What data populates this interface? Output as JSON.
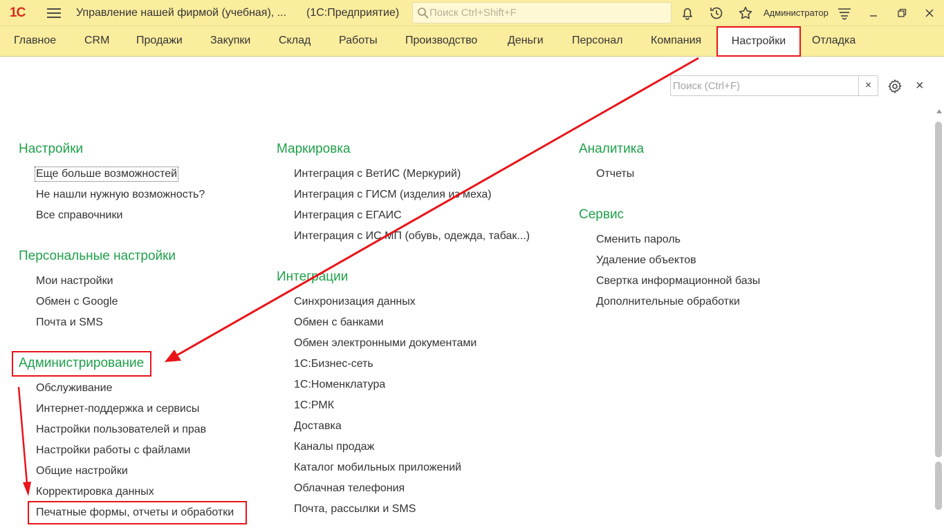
{
  "titlebar": {
    "logo": "1С",
    "app_title": "Управление нашей фирмой (учебная), ...",
    "app_subtitle": "(1С:Предприятие)",
    "search_placeholder": "Поиск Ctrl+Shift+F",
    "user_name": "Администратор",
    "icons": [
      "bell-icon",
      "history-icon",
      "star-icon",
      "menu-lines-icon",
      "restore-window-icon",
      "close-icon"
    ]
  },
  "sections": [
    {
      "label": "Главное"
    },
    {
      "label": "CRM"
    },
    {
      "label": "Продажи"
    },
    {
      "label": "Закупки"
    },
    {
      "label": "Склад"
    },
    {
      "label": "Работы"
    },
    {
      "label": "Производство"
    },
    {
      "label": "Деньги"
    },
    {
      "label": "Персонал"
    },
    {
      "label": "Компания"
    },
    {
      "label": "Настройки"
    },
    {
      "label": "Отладка"
    }
  ],
  "panel": {
    "search_placeholder": "Поиск (Ctrl+F)",
    "clear_label": "×",
    "close_label": "×"
  },
  "col1": {
    "g1": {
      "title": "Настройки",
      "items": [
        "Еще больше возможностей",
        "Не нашли нужную возможность?",
        "Все справочники"
      ]
    },
    "g2": {
      "title": "Персональные настройки",
      "items": [
        "Мои настройки",
        "Обмен с Google",
        "Почта и SMS"
      ]
    },
    "g3": {
      "title": "Администрирование",
      "items": [
        "Обслуживание",
        "Интернет-поддержка и сервисы",
        "Настройки пользователей и прав",
        "Настройки работы с файлами",
        "Общие настройки",
        "Корректировка данных",
        "Печатные формы, отчеты и обработки"
      ]
    }
  },
  "col2": {
    "g1": {
      "title": "Маркировка",
      "items": [
        "Интеграция с ВетИС (Меркурий)",
        "Интеграция с ГИСМ (изделия из меха)",
        "Интеграция с ЕГАИС",
        "Интеграция с ИС МП (обувь, одежда, табак...)"
      ]
    },
    "g2": {
      "title": "Интеграции",
      "items": [
        "Синхронизация данных",
        "Обмен с банками",
        "Обмен электронными документами",
        "1С:Бизнес-сеть",
        "1С:Номенклатура",
        "1С:РМК",
        "Доставка",
        "Каналы продаж",
        "Каталог мобильных приложений",
        "Облачная телефония",
        "Почта, рассылки и SMS"
      ]
    }
  },
  "col3": {
    "g1": {
      "title": "Аналитика",
      "items": [
        "Отчеты"
      ]
    },
    "g2": {
      "title": "Сервис",
      "items": [
        "Сменить пароль",
        "Удаление объектов",
        "Свертка информационной базы",
        "Дополнительные обработки"
      ]
    }
  },
  "colors": {
    "header_bg": "#fbed9e",
    "group_title": "#20a04b",
    "highlight_red": "#e8141a"
  }
}
